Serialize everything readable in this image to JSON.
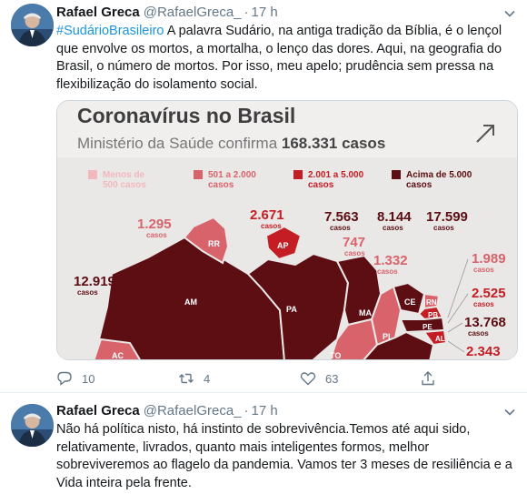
{
  "tweets": [
    {
      "author_name": "Rafael Greca",
      "author_handle": "@RafaelGreca_",
      "separator": "·",
      "time": "17 h",
      "hashtag": "#SudárioBrasileiro",
      "text": " A palavra Sudário, na antiga tradição da Bíblia, é o lençol que envolve os mortos, a mortalha, o lenço das dores. Aqui, na geografia do Brasil, o número de mortos. Por isso, meu apelo; prudência sem pressa na flexibilização do isolamento social.",
      "media": {
        "title": "Coronavírus no Brasil",
        "subtitle_prefix": "Ministério da Saúde confirma ",
        "subtitle_value": "168.331 casos",
        "legend": [
          {
            "label": "Menos de",
            "label2": "500 casos",
            "color": "#f2b8bd"
          },
          {
            "label": "501 a 2.000",
            "label2": "casos",
            "color": "#d9636b"
          },
          {
            "label": "2.001 a 5.000",
            "label2": "casos",
            "color": "#c41e24"
          },
          {
            "label": "Acima de 5.000",
            "label2": "casos",
            "color": "#5c0e12"
          }
        ],
        "case_label": "casos",
        "states": [
          "RR",
          "AP",
          "AM",
          "PA",
          "MA",
          "CE",
          "PI",
          "RN",
          "PB",
          "PE",
          "TO",
          "AC",
          "AL"
        ],
        "counts": {
          "RR": "1.295",
          "AP": "2.671",
          "AM": "12.919",
          "PA": "7.563",
          "MA": "747",
          "CE": "8.144",
          "PI": "1.332",
          "RN": "17.599",
          "PB": "1.989",
          "PE": "2.525",
          "AL": "13.768",
          "SE": "2.343"
        },
        "colors": {
          "header_bg": "#f1eeee",
          "dark": "#5c0e12",
          "medium": "#d9636b",
          "red": "#c41e24",
          "light": "#f2b8bd",
          "map_bg": "#eae7e7"
        }
      },
      "actions": {
        "replies": "10",
        "retweets": "4",
        "likes": "63"
      }
    },
    {
      "author_name": "Rafael Greca",
      "author_handle": "@RafaelGreca_",
      "separator": "·",
      "time": "17 h",
      "text": "Não há política nisto, há instinto de sobrevivência.Temos até aqui sido, relativamente, livrados, quanto mais inteligentes formos, melhor sobreviveremos ao flagelo da pandemia. Vamos ter 3 meses de resiliência e a Vida inteira pela frente."
    }
  ]
}
